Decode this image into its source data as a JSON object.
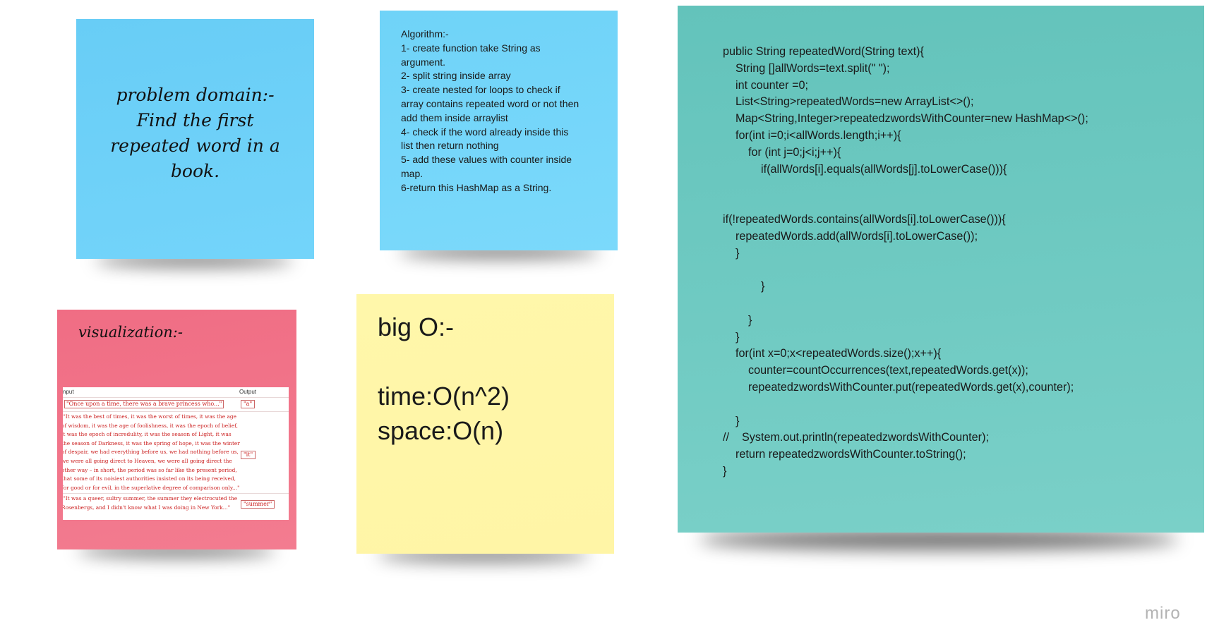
{
  "board": {
    "problem_note": {
      "text": "problem domain:-\nFind the first\nrepeated word in a\nbook."
    },
    "algorithm_note": {
      "text": "Algorithm:-\n1- create function take String as\nargument.\n2- split string inside array\n3- create nested for loops to check if\narray contains repeated word or not then\nadd them inside arraylist\n4- check if the word already inside this\nlist then return nothing\n5- add these values with counter inside\nmap.\n6-return this HashMap as a String."
    },
    "code_note": {
      "text": "public String repeatedWord(String text){\n    String []allWords=text.split(\" \");\n    int counter =0;\n    List<String>repeatedWords=new ArrayList<>();\n    Map<String,Integer>repeatedzwordsWithCounter=new HashMap<>();\n    for(int i=0;i<allWords.length;i++){\n        for (int j=0;j<i;j++){\n            if(allWords[i].equals(allWords[j].toLowerCase())){\n\n\nif(!repeatedWords.contains(allWords[i].toLowerCase())){\n    repeatedWords.add(allWords[i].toLowerCase());\n    }\n\n            }\n\n        }\n    }\n    for(int x=0;x<repeatedWords.size();x++){\n        counter=countOccurrences(text,repeatedWords.get(x));\n        repeatedzwordsWithCounter.put(repeatedWords.get(x),counter);\n\n    }\n//    System.out.println(repeatedzwordsWithCounter);\n    return repeatedzwordsWithCounter.toString();\n}"
    },
    "viz_note": {
      "title": "visualization:-",
      "table": {
        "input_header": "nput",
        "output_header": "Output",
        "row1_input": "\"Once upon a time, there was a brave princess who...\"",
        "row1_output": "\"a\"",
        "row2_input": " \"It was the best of times, it was the worst of times, it was the age\nof wisdom, it was the age of foolishness, it was the epoch of belief,\nit was the epoch of incredulity, it was the season of Light, it was\nthe season of Darkness, it was the spring of hope, it was the winter\nof despair, we had everything before us, we had nothing before us,\nwe were all going direct to Heaven, we were all going direct the\nother way – in short, the period was so far like the present period,\nthat some of its noisiest authorities insisted on its being received,\nfor good or for evil, in the superlative degree of comparison only...\"",
        "row2_output": "\"it\"",
        "row3_input": " \"It was a queer, sultry summer, the summer they electrocuted the\nRosenbergs, and I didn't know what I was doing in New York...\"",
        "row3_output": "\"summer\""
      }
    },
    "bigo_note": {
      "text": "big O:-\n\ntime:O(n^2)\nspace:O(n)"
    },
    "colors": {
      "problem_note": "#6dd0f8",
      "algorithm_note": "#76d6fa",
      "code_note": "#6ecbc3",
      "viz_note": "#f27589",
      "bigo_note": "#fff6a8"
    }
  },
  "branding": {
    "logo": "miro"
  }
}
